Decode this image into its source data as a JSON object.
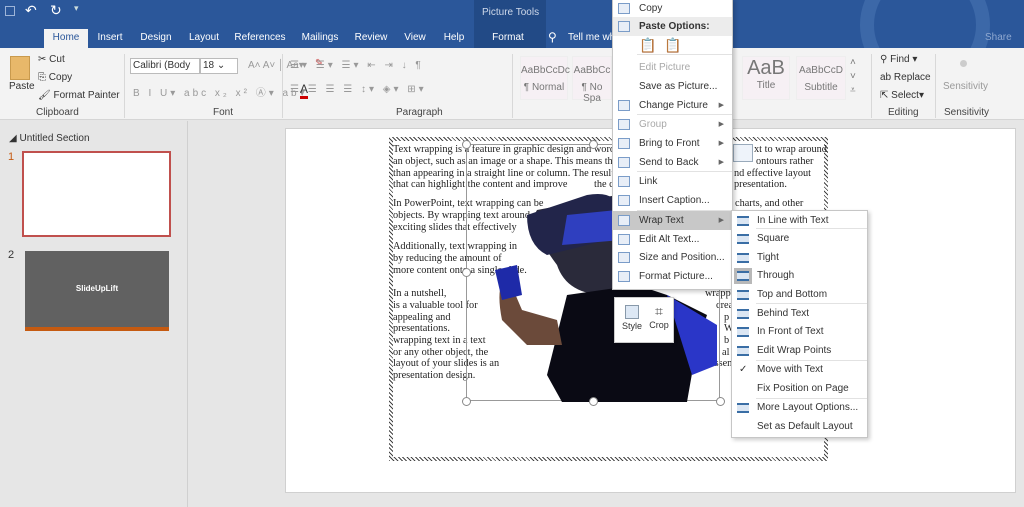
{
  "titlebar": {
    "picture_tools": "Picture Tools",
    "share": "Share",
    "tell_me": "Tell me wha"
  },
  "tabs": [
    "Home",
    "Insert",
    "Design",
    "Layout",
    "References",
    "Mailings",
    "Review",
    "View",
    "Help",
    "Format"
  ],
  "ribbon": {
    "clipboard": {
      "label": "Clipboard",
      "paste": "Paste",
      "cut": "Cut",
      "copy": "Copy",
      "format_painter": "Format Painter"
    },
    "font": {
      "label": "Font",
      "font_name": "Calibri (Body",
      "font_size": "18"
    },
    "paragraph": {
      "label": "Paragraph"
    },
    "styles": [
      {
        "preview": "AaBbCcDc",
        "name": "¶ Normal"
      },
      {
        "preview": "AaBbCc",
        "name": "¶ No Spa"
      },
      {
        "preview": "AaB",
        "name": "Title"
      },
      {
        "preview": "AaBbCcD",
        "name": "Subtitle"
      }
    ],
    "editing": {
      "label": "Editing",
      "find": "Find",
      "replace": "Replace",
      "select": "Select"
    },
    "sensitivity": {
      "label": "Sensitivity",
      "button": "Sensitivity"
    }
  },
  "navpane": {
    "section": "Untitled Section",
    "slides": [
      {
        "number": "1",
        "text": ""
      },
      {
        "number": "2",
        "text": "SlideUpLift"
      }
    ]
  },
  "document": {
    "left_lines": [
      "Text wrapping is a feature in graphic design and word",
      "an object, such as an image or a shape. This means the",
      "than appearing in a straight line or column. The result",
      "that can highlight the content and improve",
      "In PowerPoint, text wrapping can be",
      "objects. By wrapping text around",
      "exciting slides that effectively",
      "Additionally, text wrapping in",
      "by reducing the amount of",
      "more content onto a single slide.",
      "In a nutshell,",
      "is a valuable tool for",
      "appealing and",
      "presentations.",
      "wrapping text in a text",
      "or any other object, the",
      "layout of your slides is an",
      "presentation design."
    ],
    "right_lines": [
      "xt to wrap around",
      "ontours rather",
      "nd effective layout",
      "presentation.",
      "charts, and other",
      "the c",
      "wrapp",
      "crea",
      "p",
      "W",
      "b",
      "al",
      "essen"
    ]
  },
  "context_menu": [
    {
      "label": "Copy",
      "icon": "copy-icon"
    },
    {
      "label": "Paste Options:",
      "icon": "paste-icon"
    },
    {
      "label": "Edit Picture",
      "disabled": true
    },
    {
      "label": "Save as Picture..."
    },
    {
      "label": "Change Picture",
      "icon": "change-picture-icon",
      "submenu": true
    },
    {
      "label": "Group",
      "icon": "group-icon",
      "disabled": true,
      "submenu": true
    },
    {
      "label": "Bring to Front",
      "icon": "bring-front-icon",
      "submenu": true
    },
    {
      "label": "Send to Back",
      "icon": "send-back-icon",
      "submenu": true
    },
    {
      "label": "Link",
      "icon": "link-icon"
    },
    {
      "label": "Insert Caption...",
      "icon": "caption-icon"
    },
    {
      "label": "Wrap Text",
      "icon": "wrap-text-icon",
      "submenu": true,
      "highlighted": true
    },
    {
      "label": "Edit Alt Text...",
      "icon": "alt-text-icon"
    },
    {
      "label": "Size and Position...",
      "icon": "size-position-icon"
    },
    {
      "label": "Format Picture...",
      "icon": "format-picture-icon"
    }
  ],
  "wrap_submenu": [
    {
      "label": "In Line with Text"
    },
    {
      "label": "Square"
    },
    {
      "label": "Tight"
    },
    {
      "label": "Through",
      "selected": true
    },
    {
      "label": "Top and Bottom"
    },
    {
      "label": "Behind Text"
    },
    {
      "label": "In Front of Text"
    },
    {
      "label": "Edit Wrap Points"
    },
    {
      "label": "Move with Text",
      "checked": true
    },
    {
      "label": "Fix Position on Page"
    },
    {
      "label": "More Layout Options..."
    },
    {
      "label": "Set as Default Layout"
    }
  ],
  "mini_toolbar": {
    "style": "Style",
    "crop": "Crop"
  },
  "colors": {
    "brand": "#2b579a",
    "accent_slide": "#c55a11",
    "selection": "#c8c8c8"
  }
}
